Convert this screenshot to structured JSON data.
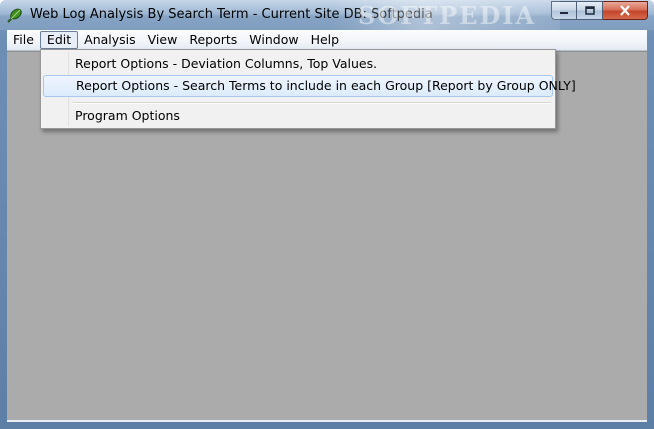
{
  "window": {
    "title": "Web Log Analysis By Search Term - Current Site DB: Softpedia",
    "watermark": "SOFTPEDIA",
    "icon": "app-leaf-icon"
  },
  "caption_buttons": {
    "minimize_icon": "minimize-icon",
    "maximize_icon": "maximize-icon",
    "close_icon": "close-icon"
  },
  "menubar": {
    "items": [
      {
        "label": "File"
      },
      {
        "label": "Edit",
        "active": true
      },
      {
        "label": "Analysis"
      },
      {
        "label": "View"
      },
      {
        "label": "Reports"
      },
      {
        "label": "Window"
      },
      {
        "label": "Help"
      }
    ]
  },
  "edit_menu": {
    "items": [
      {
        "label": "Report Options - Deviation Columns, Top Values."
      },
      {
        "label": "Report Options - Search Terms to include in each Group [Report by Group ONLY]",
        "highlighted": true
      },
      {
        "label": "Program Options"
      }
    ]
  },
  "colors": {
    "client_background": "#ababab",
    "menu_highlight": "#dcebfc",
    "titlebar": "#9fb8d4"
  }
}
